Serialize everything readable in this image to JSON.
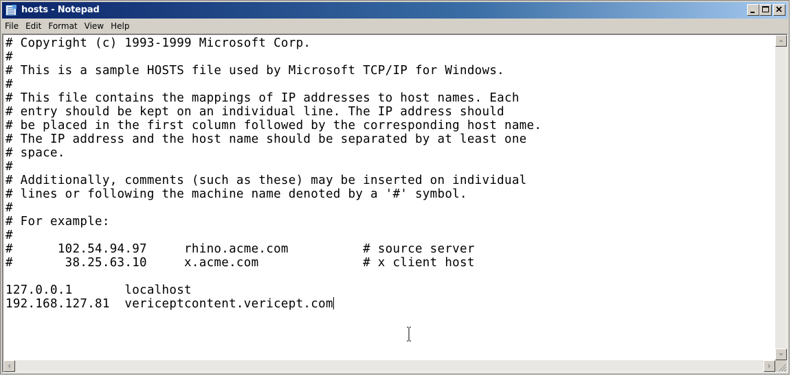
{
  "window": {
    "title": "hosts - Notepad"
  },
  "menu": {
    "items": [
      "File",
      "Edit",
      "Format",
      "View",
      "Help"
    ]
  },
  "editor": {
    "lines": [
      "# Copyright (c) 1993-1999 Microsoft Corp.",
      "#",
      "# This is a sample HOSTS file used by Microsoft TCP/IP for Windows.",
      "#",
      "# This file contains the mappings of IP addresses to host names. Each",
      "# entry should be kept on an individual line. The IP address should",
      "# be placed in the first column followed by the corresponding host name.",
      "# The IP address and the host name should be separated by at least one",
      "# space.",
      "#",
      "# Additionally, comments (such as these) may be inserted on individual",
      "# lines or following the machine name denoted by a '#' symbol.",
      "#",
      "# For example:",
      "#",
      "#      102.54.94.97     rhino.acme.com          # source server",
      "#       38.25.63.10     x.acme.com              # x client host",
      "",
      "127.0.0.1       localhost",
      "192.168.127.81  vericeptcontent.vericept.com"
    ]
  },
  "icons": {
    "app": "notepad-icon",
    "minimize": "minimize-icon",
    "maximize": "maximize-icon",
    "close": "close-icon",
    "scroll_up": "arrow-up-icon",
    "scroll_down": "arrow-down-icon",
    "scroll_left": "arrow-left-icon",
    "scroll_right": "arrow-right-icon",
    "cursor": "text-cursor-icon",
    "grip": "resize-grip-icon"
  }
}
